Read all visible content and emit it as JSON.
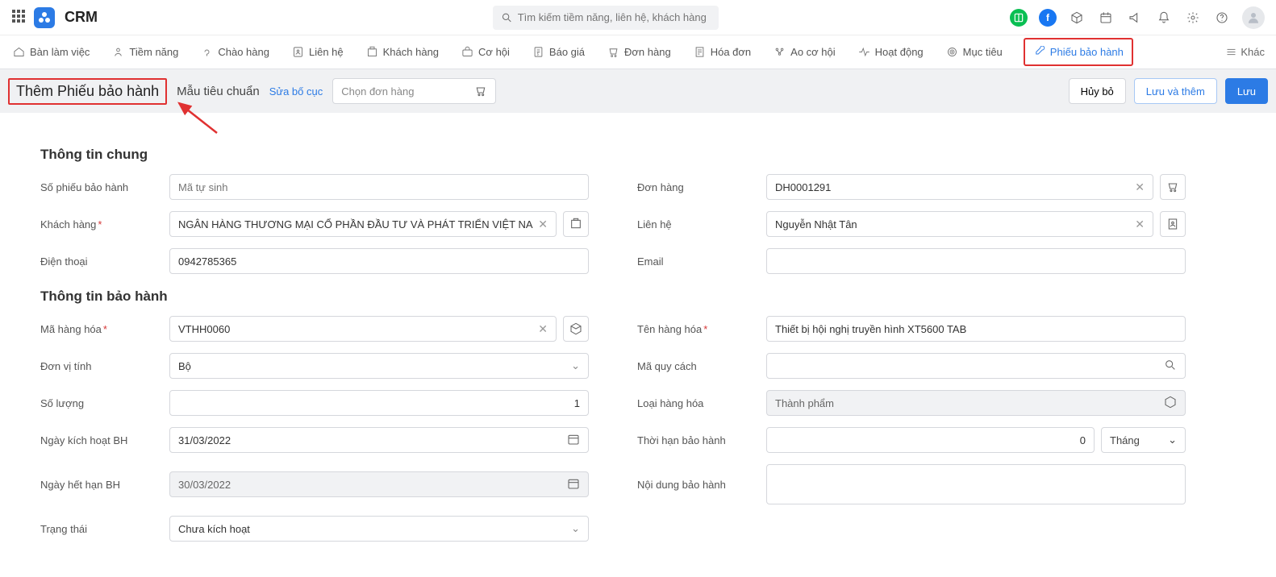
{
  "app": {
    "title": "CRM"
  },
  "search": {
    "placeholder": "Tìm kiếm tiềm năng, liên hệ, khách hàng"
  },
  "nav": {
    "items": [
      "Bàn làm việc",
      "Tiềm năng",
      "Chào hàng",
      "Liên hệ",
      "Khách hàng",
      "Cơ hội",
      "Báo giá",
      "Đơn hàng",
      "Hóa đơn",
      "Ao cơ hội",
      "Hoạt động",
      "Mục tiêu",
      "Phiếu bảo hành"
    ],
    "more": "Khác"
  },
  "subbar": {
    "title": "Thêm Phiếu bảo hành",
    "template": "Mẫu tiêu chuẩn",
    "edit": "Sửa bố cục",
    "order_placeholder": "Chọn đơn hàng",
    "cancel": "Hủy bỏ",
    "save_add": "Lưu và thêm",
    "save": "Lưu"
  },
  "sections": {
    "general": "Thông tin chung",
    "warranty": "Thông tin bảo hành"
  },
  "labels": {
    "ticket_no": "Số phiếu bảo hành",
    "order": "Đơn hàng",
    "customer": "Khách hàng",
    "contact": "Liên hệ",
    "phone": "Điện thoại",
    "email": "Email",
    "item_code": "Mã hàng hóa",
    "item_name": "Tên hàng hóa",
    "unit": "Đơn vị tính",
    "spec_code": "Mã quy cách",
    "qty": "Số lượng",
    "item_type": "Loại hàng hóa",
    "activate_date": "Ngày kích hoạt BH",
    "period": "Thời hạn bảo hành",
    "expire_date": "Ngày hết hạn BH",
    "content": "Nội dung bảo hành",
    "status": "Trạng thái"
  },
  "values": {
    "ticket_no_ph": "Mã tự sinh",
    "order": "DH0001291",
    "customer": "NGÂN HÀNG THƯƠNG MẠI CỔ PHẦN ĐẦU TƯ VÀ PHÁT TRIỂN VIỆT NAM - ...",
    "contact": "Nguyễn Nhật Tân",
    "phone": "0942785365",
    "email": "",
    "item_code": "VTHH0060",
    "item_name": "Thiết bị hội nghị truyền hình XT5600 TAB",
    "unit": "Bộ",
    "spec_code": "",
    "qty": "1",
    "item_type": "Thành phẩm",
    "activate_date": "31/03/2022",
    "period_value": "0",
    "period_unit": "Tháng",
    "expire_date": "30/03/2022",
    "content": "",
    "status": "Chưa kích hoạt"
  }
}
